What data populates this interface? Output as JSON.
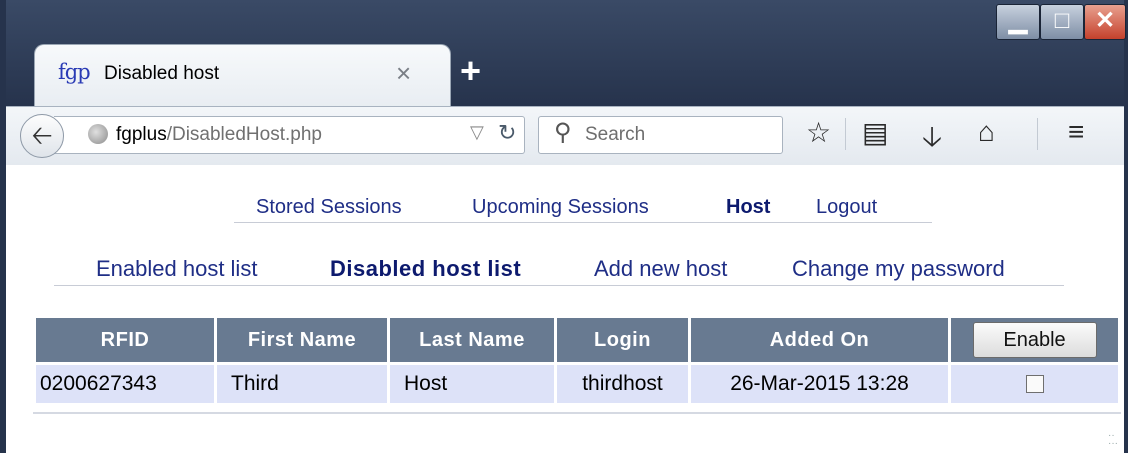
{
  "browser": {
    "tab": {
      "logo": "fgp",
      "title": "Disabled host",
      "close": "×"
    },
    "new_tab": "+",
    "window_controls": {
      "minimize": "▁",
      "maximize": "□",
      "close": "✕"
    },
    "url": {
      "host": "fgplus",
      "path": "/DisabledHost.php"
    },
    "search_placeholder": "Search",
    "icons": [
      "back-arrow-icon",
      "globe-icon",
      "dropdown-icon",
      "reload-icon",
      "search-icon",
      "star-icon",
      "reading-list-icon",
      "download-icon",
      "home-icon",
      "menu-icon"
    ]
  },
  "topnav": {
    "items": [
      "Stored Sessions",
      "Upcoming Sessions",
      "Host",
      "Logout"
    ],
    "active": "Host"
  },
  "subnav": {
    "items": [
      "Enabled host list",
      "Disabled host list",
      "Add new host",
      "Change my password"
    ],
    "active": "Disabled host list"
  },
  "table": {
    "headers": [
      "RFID",
      "First Name",
      "Last Name",
      "Login",
      "Added On"
    ],
    "enable_button": "Enable",
    "rows": [
      {
        "rfid": "0200627343",
        "first": "Third",
        "last": "Host",
        "login": "thirdhost",
        "added": "26-Mar-2015 13:28",
        "checked": false
      }
    ]
  },
  "colors": {
    "header_bg": "#687a91",
    "row_bg": "#dde2f8",
    "link": "#1f2e86"
  }
}
